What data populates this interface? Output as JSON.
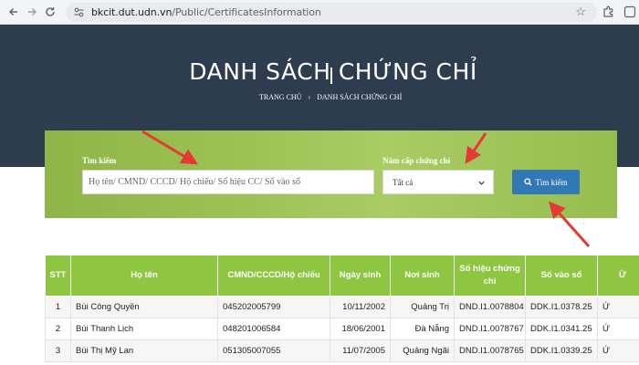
{
  "browser": {
    "url_domain": "bkcit.dut.udn.vn",
    "url_path": "/Public/CertificatesInformation",
    "back_icon": "arrow-left-icon",
    "forward_icon": "arrow-right-icon",
    "reload_icon": "reload-icon"
  },
  "hero": {
    "title": "DANH SÁCH CHỨNG CHỈ",
    "breadcrumb_home": "TRANG CHỦ",
    "breadcrumb_separator": "›",
    "breadcrumb_current": "DANH SÁCH CHỨNG CHỈ"
  },
  "search": {
    "label": "Tìm kiếm",
    "placeholder": "Họ tên/ CMND/ CCCD/ Hộ chiếu/ Số hiệu CC/ Số vào sổ",
    "year_label": "Năm cấp chứng chỉ",
    "year_value": "Tất cả",
    "button_label": "Tìm kiếm"
  },
  "table": {
    "headers": [
      "STT",
      "Họ tên",
      "CMND/CCCD/Hộ chiếu",
      "Ngày sinh",
      "Nơi sinh",
      "Số hiệu chứng chỉ",
      "Số vào sổ",
      "Ứ"
    ],
    "rows": [
      {
        "stt": "1",
        "name": "Bùi Công Quyền",
        "id": "045202005799",
        "dob": "10/11/2002",
        "place": "Quảng Trị",
        "cert": "DND.I1.0078804",
        "book": "DDK.I1.0378.25",
        "extra": "Ứ"
      },
      {
        "stt": "2",
        "name": "Bùi Thanh Lịch",
        "id": "048201006584",
        "dob": "18/06/2001",
        "place": "Đà Nẵng",
        "cert": "DND.I1.0078767",
        "book": "DDK.I1.0341.25",
        "extra": "Ứ"
      },
      {
        "stt": "3",
        "name": "Bùi Thị Mỹ Lan",
        "id": "051305007055",
        "dob": "11/07/2005",
        "place": "Quảng Ngãi",
        "cert": "DND.I1.0078765",
        "book": "DDK.I1.0339.25",
        "extra": "Ứ"
      }
    ]
  },
  "colors": {
    "hero_bg": "#2e3c50",
    "panel_green": "#9cc254",
    "table_header": "#8ec641",
    "button_blue": "#3178b6",
    "arrow_red": "#e53935"
  }
}
